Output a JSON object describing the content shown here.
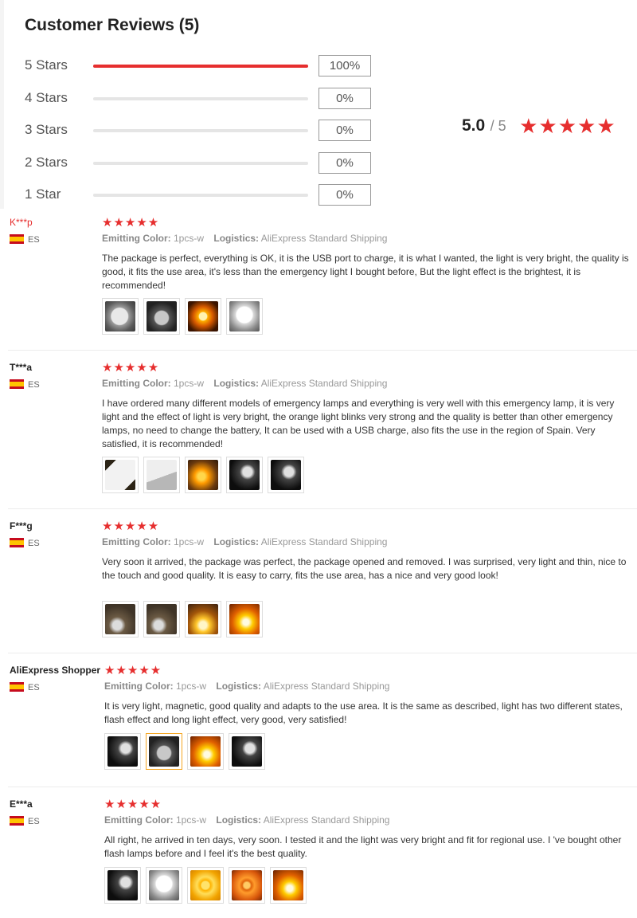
{
  "summary": {
    "title": "Customer Reviews (5)",
    "distribution": [
      {
        "label": "5 Stars",
        "percent": "100%",
        "fill": 1.0
      },
      {
        "label": "4 Stars",
        "percent": "0%",
        "fill": 0
      },
      {
        "label": "3 Stars",
        "percent": "0%",
        "fill": 0
      },
      {
        "label": "2 Stars",
        "percent": "0%",
        "fill": 0
      },
      {
        "label": "1 Star",
        "percent": "0%",
        "fill": 0
      }
    ],
    "average": "5.0",
    "average_max": "/ 5",
    "stars": "★★★★★"
  },
  "labels": {
    "color_label": "Emitting Color:",
    "logistics_label": "Logistics:"
  },
  "colors": {
    "accent": "#e62e2e",
    "star": "#e62e2e",
    "selected_thumb": "#f5a623"
  },
  "reviews": [
    {
      "name": "K***p",
      "country": "ES",
      "rating": "★★★★★",
      "color": "1pcs-w",
      "logistics": "AliExpress Standard Shipping",
      "text": "The package is perfect, everything is OK, it is the USB port to charge, it is what I wanted, the light is very bright, the quality is good, it fits the use area, it's less than the emergency light I bought before, But the light effect is the brightest, it is recommended!",
      "photos": [
        "t-silver",
        "t-dark",
        "t-orange",
        "t-white"
      ]
    },
    {
      "name": "T***a",
      "country": "ES",
      "rating": "★★★★★",
      "color": "1pcs-w",
      "logistics": "AliExpress Standard Shipping",
      "text": "I have ordered many different models of emergency lamps and everything is very well with this emergency lamp, it is very light and the effect of light is very bright, the orange light blinks very strong and the quality is better than other emergency lamps, no need to change the battery, It can be used with a USB charge, also fits the use in the region of Spain. Very satisfied, it is recommended!",
      "photos": [
        "t-box",
        "t-paper",
        "t-orange2",
        "t-night",
        "t-night"
      ]
    },
    {
      "name": "F***g",
      "country": "ES",
      "rating": "★★★★★",
      "color": "1pcs-w",
      "logistics": "AliExpress Standard Shipping",
      "text": "Very soon it arrived, the package was perfect, the package opened and removed. I was surprised, very light and thin, nice to the touch and good quality. It is easy to carry, fits the use area, has a nice and very good look!",
      "photos": [
        "t-brown",
        "t-brown",
        "t-amber",
        "t-fire"
      ]
    },
    {
      "name": "AliExpress Shopper",
      "country": "ES",
      "rating": "★★★★★",
      "color": "1pcs-w",
      "logistics": "AliExpress Standard Shipping",
      "text": "It is very light, magnetic, good quality and adapts to the use area. It is the same as described, light has two different states, flash effect and long light effect, very good, very satisfied!",
      "photos": [
        "t-night",
        "t-dark",
        "t-fire",
        "t-night"
      ]
    },
    {
      "name": "E***a",
      "country": "ES",
      "rating": "★★★★★",
      "color": "1pcs-w",
      "logistics": "AliExpress Standard Shipping",
      "text": "All right, he arrived in ten days, very soon. I tested it and the light was very bright and fit for regional use. I 've bought other flash lamps before and I feel it's the best quality.",
      "photos": [
        "t-night",
        "t-white",
        "t-ring",
        "t-ring2",
        "t-fire"
      ]
    }
  ]
}
